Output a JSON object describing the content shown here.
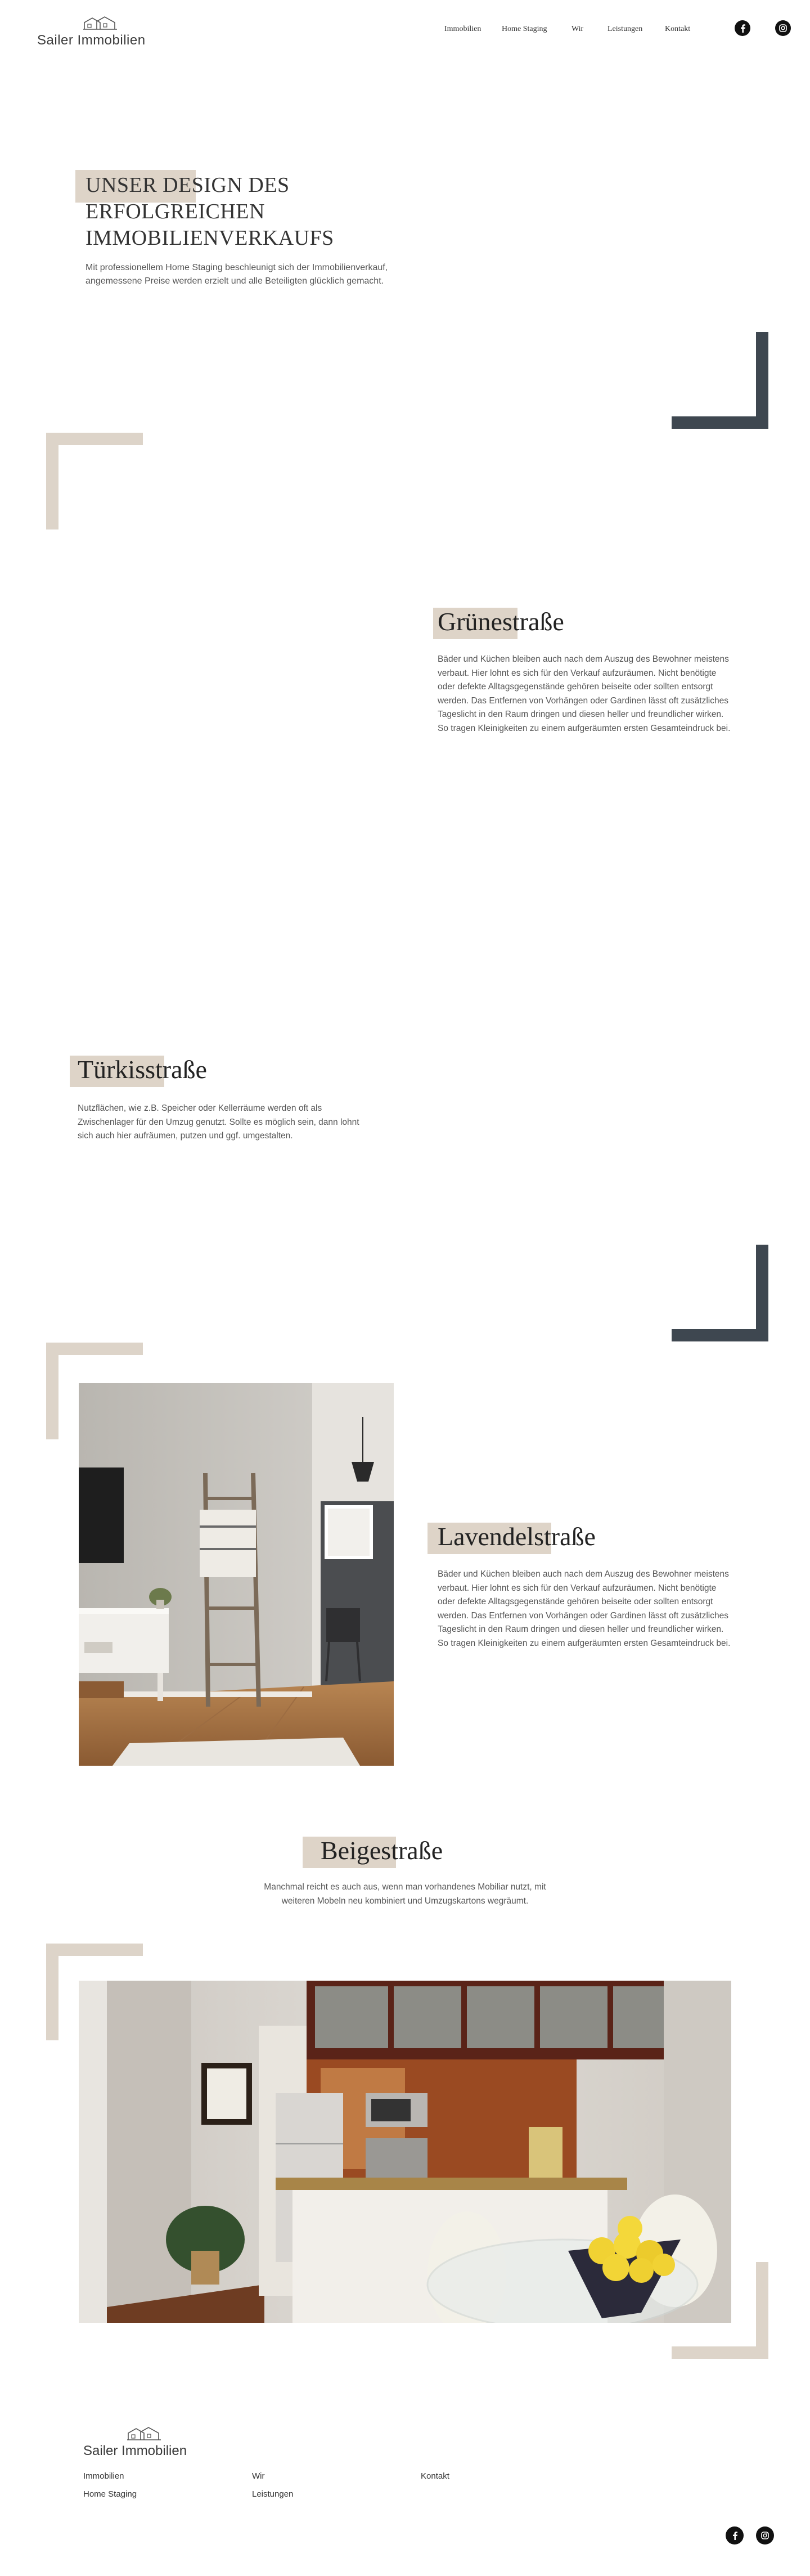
{
  "header": {
    "logo_text": "Sailer Immobilien",
    "nav": [
      "Immobilien",
      "Home Staging",
      "Wir",
      "Leistungen",
      "Kontakt"
    ],
    "social": [
      "facebook-icon",
      "instagram-icon"
    ]
  },
  "hero": {
    "title_line1": "UNSER DESIGN DES",
    "title_line2": "ERFOLGREICHEN",
    "title_line3": "IMMOBILIENVERKAUFS",
    "subtitle": "Mit professionellem Home Staging beschleunigt sich der Immobilienverkauf, angemessene Preise werden erzielt und alle Beteiligten glücklich gemacht."
  },
  "sections": [
    {
      "title": "Grünestraße",
      "body": "Bäder und Küchen bleiben auch nach dem Auszug des Bewohner meistens verbaut. Hier lohnt es sich für den Verkauf aufzuräumen. Nicht benötigte oder defekte Alltagsgegenstände gehören beiseite oder sollten entsorgt werden. Das Entfernen von Vorhängen oder Gardinen lässt oft zusätzliches Tageslicht in den Raum dringen und diesen heller und freundlicher wirken. So tragen Kleinigkeiten zu einem aufgeräumten ersten Gesamteindruck bei."
    },
    {
      "title": "Türkisstraße",
      "body": "Nutzflächen, wie z.B. Speicher oder Kellerräume werden oft als Zwischenlager für den Umzug genutzt. Sollte es möglich sein, dann lohnt sich auch hier aufräumen, putzen und ggf. umgestalten."
    },
    {
      "title": "Lavendelstraße",
      "body": "Bäder und Küchen bleiben auch nach dem Auszug des Bewohner meistens verbaut. Hier lohnt es sich für den Verkauf aufzuräumen. Nicht benötigte oder defekte Alltagsgegenstände gehören beiseite oder sollten entsorgt werden. Das Entfernen von Vorhängen oder Gardinen lässt oft zusätzliches Tageslicht in den Raum dringen und diesen heller und freundlicher wirken. So tragen Kleinigkeiten zu einem aufgeräumten ersten Gesamteindruck bei."
    },
    {
      "title": "Beigestraße",
      "body": "Manchmal reicht es auch aus, wenn man vorhandenes Mobiliar nutzt, mit weiteren Mobeln neu kombiniert und Umzugskartons wegräumt."
    }
  ],
  "footer": {
    "logo_text": "Sailer Immobilien",
    "col1": [
      "Immobilien",
      "Home Staging"
    ],
    "col2": [
      "Wir",
      "Leistungen"
    ],
    "col3": [
      "Kontakt"
    ],
    "social": [
      "facebook-icon",
      "instagram-icon"
    ]
  },
  "colors": {
    "accent_beige": "#ded4c8",
    "bracket_dark": "#3e4750"
  }
}
